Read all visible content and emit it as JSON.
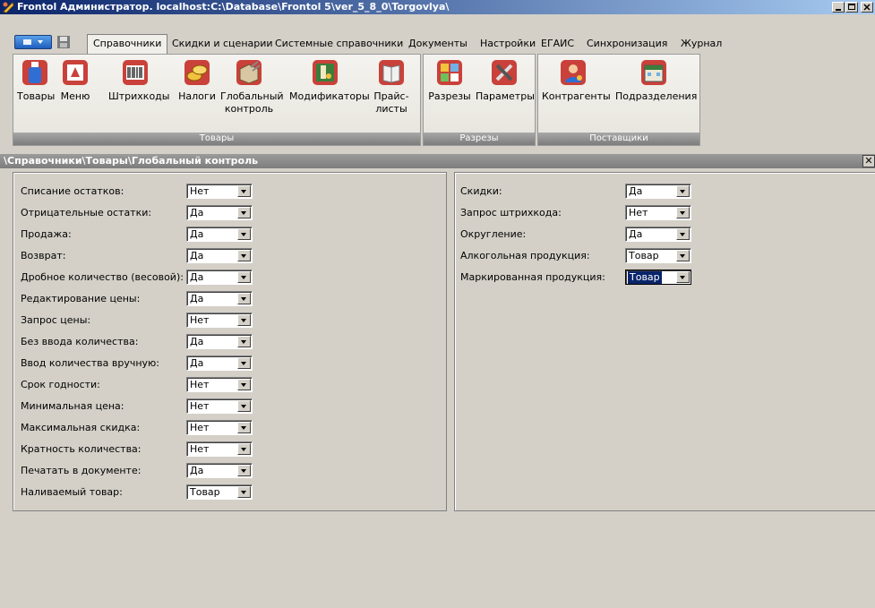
{
  "window": {
    "title": "Frontol Администратор. localhost:C:\\Database\\Frontol 5\\ver_5_8_0\\Torgovlya\\"
  },
  "menu": {
    "tabs": [
      {
        "label": "Справочники",
        "active": true
      },
      {
        "label": "Скидки и сценарии"
      },
      {
        "label": "Системные справочники"
      },
      {
        "label": "Документы"
      },
      {
        "label": "Настройки"
      },
      {
        "label": "ЕГАИС"
      },
      {
        "label": "Синхронизация"
      },
      {
        "label": "Журнал"
      }
    ]
  },
  "ribbon": {
    "groups": [
      {
        "label": "Товары",
        "buttons": [
          {
            "label": "Товары",
            "icon": "bottle-icon"
          },
          {
            "label": "Меню",
            "icon": "menu-icon"
          },
          {
            "label": "Штрихкоды",
            "icon": "barcode-icon"
          },
          {
            "label": "Налоги",
            "icon": "coins-icon"
          },
          {
            "label": "Глобальный контроль",
            "label_line1": "Глобальный",
            "label_line2": "контроль",
            "icon": "box-control-icon"
          },
          {
            "label": "Модификаторы",
            "icon": "modifiers-icon"
          },
          {
            "label": "Прайс-листы",
            "label_line1": "Прайс-",
            "label_line2": "листы",
            "icon": "pricelist-icon"
          }
        ]
      },
      {
        "label": "Разрезы",
        "buttons": [
          {
            "label": "Разрезы",
            "icon": "slices-icon"
          },
          {
            "label": "Параметры",
            "icon": "tools-icon"
          }
        ]
      },
      {
        "label": "Поставщики",
        "buttons": [
          {
            "label": "Контрагенты",
            "icon": "contractor-icon"
          },
          {
            "label": "Подразделения",
            "icon": "division-icon"
          }
        ]
      }
    ]
  },
  "breadcrumb": "\\Справочники\\Товары\\Глобальный контроль",
  "form": {
    "left": [
      {
        "label": "Списание остатков:",
        "value": "Нет"
      },
      {
        "label": "Отрицательные остатки:",
        "value": "Да"
      },
      {
        "label": "Продажа:",
        "value": "Да"
      },
      {
        "label": "Возврат:",
        "value": "Да"
      },
      {
        "label": "Дробное количество (весовой):",
        "value": "Да"
      },
      {
        "label": "Редактирование цены:",
        "value": "Да"
      },
      {
        "label": "Запрос цены:",
        "value": "Нет"
      },
      {
        "label": "Без ввода количества:",
        "value": "Да"
      },
      {
        "label": "Ввод количества вручную:",
        "value": "Да"
      },
      {
        "label": "Срок годности:",
        "value": "Нет"
      },
      {
        "label": "Минимальная цена:",
        "value": "Нет"
      },
      {
        "label": "Максимальная скидка:",
        "value": "Нет"
      },
      {
        "label": "Кратность количества:",
        "value": "Нет"
      },
      {
        "label": "Печатать в документе:",
        "value": "Да"
      },
      {
        "label": "Наливаемый товар:",
        "value": "Товар"
      }
    ],
    "right": [
      {
        "label": "Скидки:",
        "value": "Да"
      },
      {
        "label": "Запрос штрихкода:",
        "value": "Нет"
      },
      {
        "label": "Округление:",
        "value": "Да"
      },
      {
        "label": "Алкогольная продукция:",
        "value": "Товар"
      },
      {
        "label": "Маркированная продукция:",
        "value": "Товар",
        "focused": true
      }
    ]
  }
}
